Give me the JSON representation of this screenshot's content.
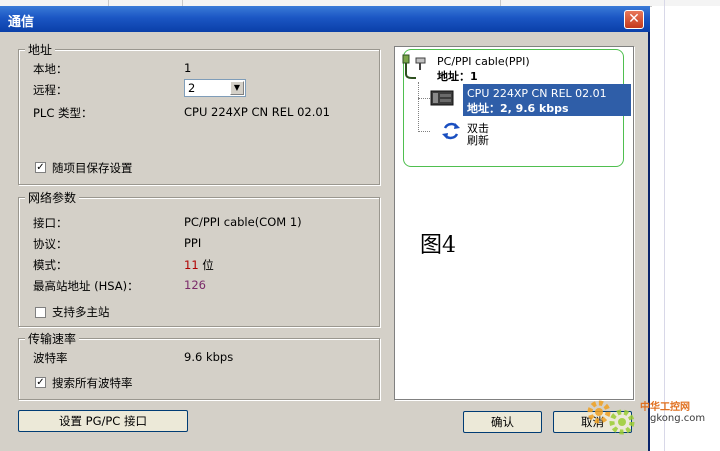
{
  "window": {
    "title": "通信"
  },
  "address": {
    "group_title": "地址",
    "local_label": "本地：",
    "local_value": "1",
    "remote_label": "远程：",
    "remote_value": "2",
    "plc_type_label": "PLC 类型：",
    "plc_type_value": "CPU 224XP CN REL 02.01",
    "save_with_project_label": "随项目保存设置",
    "save_with_project_checked": true
  },
  "network": {
    "group_title": "网络参数",
    "interface_label": "接口：",
    "interface_value": "PC/PPI cable(COM 1)",
    "protocol_label": "协议：",
    "protocol_value": "PPI",
    "mode_label": "模式：",
    "mode_value_num": "11",
    "mode_value_unit": "位",
    "hsa_label": "最高站地址 (HSA)：",
    "hsa_value": "126",
    "multimaster_label": "支持多主站",
    "multimaster_checked": false
  },
  "baud": {
    "group_title": "传输速率",
    "baud_label": "波特率",
    "baud_value": "9.6 kbps",
    "search_all_label": "搜索所有波特率",
    "search_all_checked": true
  },
  "tree": {
    "cable_line1": "PC/PPI cable(PPI)",
    "cable_line2": "地址：1",
    "cpu_line1": "CPU 224XP CN REL 02.01",
    "cpu_line2": "地址：2, 9.6 kbps",
    "refresh_line1": "双击",
    "refresh_line2": "刷新",
    "figure_label": "图4"
  },
  "buttons": {
    "set_pgpc": "设置 PG/PC 接口",
    "ok": "确认",
    "cancel": "取消"
  },
  "watermark": {
    "line1": "中华工控网",
    "line2": "gkong.com"
  },
  "colors": {
    "title_bar": "#1b56c4",
    "dialog_bg": "#d4d0c8",
    "selection": "#2f5ea8",
    "green_frame": "#4fbf4f",
    "mode_value": "#b00000",
    "hsa_value": "#7a2a6a"
  },
  "icons": [
    "close-icon",
    "cable-icon",
    "cpu-icon",
    "refresh-icon",
    "dropdown-arrow-icon",
    "check-icon",
    "gear-watermark-icon"
  ]
}
